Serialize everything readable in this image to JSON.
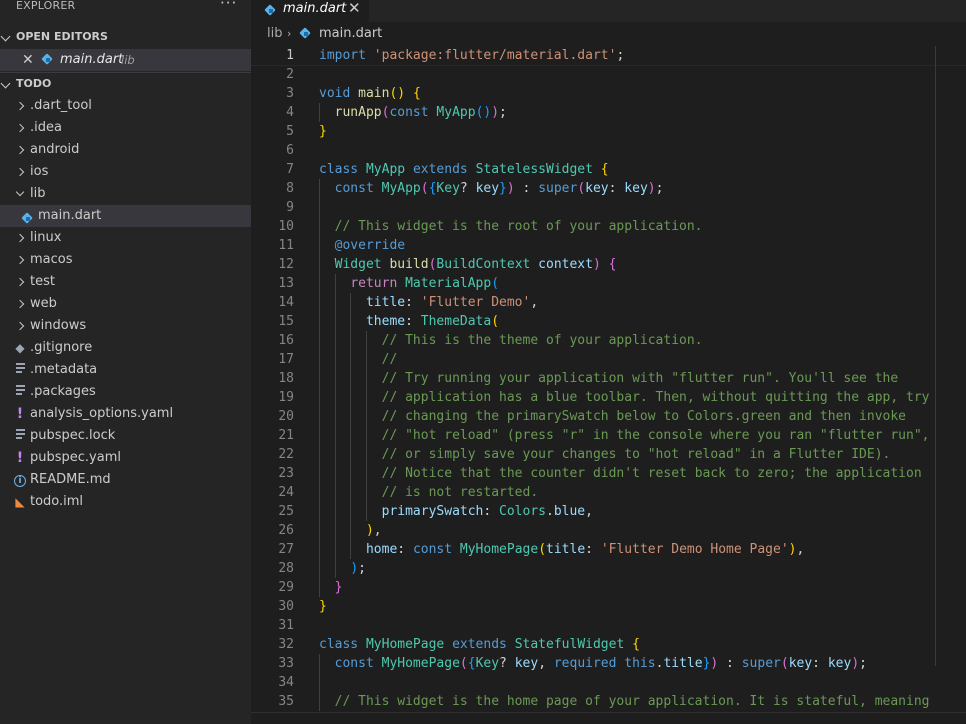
{
  "sidebar": {
    "title": "EXPLORER",
    "more": "···",
    "open_editors": {
      "label": "OPEN EDITORS",
      "items": [
        {
          "name": "main.dart",
          "dir": "lib",
          "close": "✕"
        }
      ]
    },
    "workspace": {
      "label": "TODO",
      "items": [
        {
          "name": ".dart_tool",
          "kind": "folder"
        },
        {
          "name": ".idea",
          "kind": "folder"
        },
        {
          "name": "android",
          "kind": "folder"
        },
        {
          "name": "ios",
          "kind": "folder"
        },
        {
          "name": "lib",
          "kind": "folder-open"
        },
        {
          "name": "main.dart",
          "kind": "dart"
        },
        {
          "name": "linux",
          "kind": "folder"
        },
        {
          "name": "macos",
          "kind": "folder"
        },
        {
          "name": "test",
          "kind": "folder"
        },
        {
          "name": "web",
          "kind": "folder"
        },
        {
          "name": "windows",
          "kind": "folder"
        },
        {
          "name": ".gitignore",
          "kind": "git"
        },
        {
          "name": ".metadata",
          "kind": "lines"
        },
        {
          "name": ".packages",
          "kind": "lines"
        },
        {
          "name": "analysis_options.yaml",
          "kind": "yaml"
        },
        {
          "name": "pubspec.lock",
          "kind": "lines"
        },
        {
          "name": "pubspec.yaml",
          "kind": "yaml"
        },
        {
          "name": "README.md",
          "kind": "info"
        },
        {
          "name": "todo.iml",
          "kind": "rss"
        }
      ]
    }
  },
  "tab": {
    "label": "main.dart",
    "close": "✕"
  },
  "breadcrumb": {
    "folder": "lib",
    "separator": "›",
    "file": "main.dart"
  },
  "colors": {
    "keyword": "#569cd6",
    "control": "#c586c0",
    "string": "#ce9178",
    "type": "#4ec9b0",
    "function": "#dcdcaa",
    "variable": "#9cdcfe",
    "comment": "#6a9955",
    "plain": "#d4d4d4",
    "bracket1": "#ffd700",
    "bracket2": "#da70d6",
    "bracket3": "#179fff"
  },
  "editor": {
    "current_line": 1,
    "lines": [
      {
        "n": 1,
        "indent": 0,
        "tokens": [
          [
            "kw",
            "import"
          ],
          [
            "pl",
            " "
          ],
          [
            "str",
            "'package:flutter/material.dart'"
          ],
          [
            "pl",
            ";"
          ]
        ]
      },
      {
        "n": 2,
        "indent": 0,
        "tokens": []
      },
      {
        "n": 3,
        "indent": 0,
        "tokens": [
          [
            "kw",
            "void"
          ],
          [
            "pl",
            " "
          ],
          [
            "fn",
            "main"
          ],
          [
            "b1",
            "()"
          ],
          [
            "pl",
            " "
          ],
          [
            "b1",
            "{"
          ]
        ]
      },
      {
        "n": 4,
        "indent": 1,
        "tokens": [
          [
            "pl",
            "  "
          ],
          [
            "fn",
            "runApp"
          ],
          [
            "b2",
            "("
          ],
          [
            "kw",
            "const"
          ],
          [
            "pl",
            " "
          ],
          [
            "ty",
            "MyApp"
          ],
          [
            "b3",
            "()"
          ],
          [
            "b2",
            ")"
          ],
          [
            "pl",
            ";"
          ]
        ]
      },
      {
        "n": 5,
        "indent": 0,
        "tokens": [
          [
            "b1",
            "}"
          ]
        ]
      },
      {
        "n": 6,
        "indent": 0,
        "tokens": []
      },
      {
        "n": 7,
        "indent": 0,
        "tokens": [
          [
            "kw",
            "class"
          ],
          [
            "pl",
            " "
          ],
          [
            "ty",
            "MyApp"
          ],
          [
            "pl",
            " "
          ],
          [
            "kw",
            "extends"
          ],
          [
            "pl",
            " "
          ],
          [
            "ty",
            "StatelessWidget"
          ],
          [
            "pl",
            " "
          ],
          [
            "b1",
            "{"
          ]
        ]
      },
      {
        "n": 8,
        "indent": 1,
        "tokens": [
          [
            "pl",
            "  "
          ],
          [
            "kw",
            "const"
          ],
          [
            "pl",
            " "
          ],
          [
            "ty",
            "MyApp"
          ],
          [
            "b2",
            "("
          ],
          [
            "b3",
            "{"
          ],
          [
            "ty",
            "Key"
          ],
          [
            "pl",
            "? "
          ],
          [
            "var",
            "key"
          ],
          [
            "b3",
            "}"
          ],
          [
            "b2",
            ")"
          ],
          [
            "pl",
            " : "
          ],
          [
            "kw",
            "super"
          ],
          [
            "b2",
            "("
          ],
          [
            "var",
            "key"
          ],
          [
            "pl",
            ": "
          ],
          [
            "var",
            "key"
          ],
          [
            "b2",
            ")"
          ],
          [
            "pl",
            ";"
          ]
        ]
      },
      {
        "n": 9,
        "indent": 1,
        "tokens": []
      },
      {
        "n": 10,
        "indent": 1,
        "tokens": [
          [
            "pl",
            "  "
          ],
          [
            "com",
            "// This widget is the root of your application."
          ]
        ]
      },
      {
        "n": 11,
        "indent": 1,
        "tokens": [
          [
            "pl",
            "  "
          ],
          [
            "kw",
            "@override"
          ]
        ]
      },
      {
        "n": 12,
        "indent": 1,
        "tokens": [
          [
            "pl",
            "  "
          ],
          [
            "ty",
            "Widget"
          ],
          [
            "pl",
            " "
          ],
          [
            "fn",
            "build"
          ],
          [
            "b2",
            "("
          ],
          [
            "ty",
            "BuildContext"
          ],
          [
            "pl",
            " "
          ],
          [
            "var",
            "context"
          ],
          [
            "b2",
            ")"
          ],
          [
            "pl",
            " "
          ],
          [
            "b2",
            "{"
          ]
        ]
      },
      {
        "n": 13,
        "indent": 2,
        "tokens": [
          [
            "pl",
            "    "
          ],
          [
            "ctl",
            "return"
          ],
          [
            "pl",
            " "
          ],
          [
            "ty",
            "MaterialApp"
          ],
          [
            "b3",
            "("
          ]
        ]
      },
      {
        "n": 14,
        "indent": 3,
        "tokens": [
          [
            "pl",
            "      "
          ],
          [
            "var",
            "title"
          ],
          [
            "pl",
            ": "
          ],
          [
            "str",
            "'Flutter Demo'"
          ],
          [
            "pl",
            ","
          ]
        ]
      },
      {
        "n": 15,
        "indent": 3,
        "tokens": [
          [
            "pl",
            "      "
          ],
          [
            "var",
            "theme"
          ],
          [
            "pl",
            ": "
          ],
          [
            "ty",
            "ThemeData"
          ],
          [
            "b1",
            "("
          ]
        ]
      },
      {
        "n": 16,
        "indent": 4,
        "tokens": [
          [
            "pl",
            "        "
          ],
          [
            "com",
            "// This is the theme of your application."
          ]
        ]
      },
      {
        "n": 17,
        "indent": 4,
        "tokens": [
          [
            "pl",
            "        "
          ],
          [
            "com",
            "//"
          ]
        ]
      },
      {
        "n": 18,
        "indent": 4,
        "tokens": [
          [
            "pl",
            "        "
          ],
          [
            "com",
            "// Try running your application with \"flutter run\". You'll see the"
          ]
        ]
      },
      {
        "n": 19,
        "indent": 4,
        "tokens": [
          [
            "pl",
            "        "
          ],
          [
            "com",
            "// application has a blue toolbar. Then, without quitting the app, try"
          ]
        ]
      },
      {
        "n": 20,
        "indent": 4,
        "tokens": [
          [
            "pl",
            "        "
          ],
          [
            "com",
            "// changing the primarySwatch below to Colors.green and then invoke"
          ]
        ]
      },
      {
        "n": 21,
        "indent": 4,
        "tokens": [
          [
            "pl",
            "        "
          ],
          [
            "com",
            "// \"hot reload\" (press \"r\" in the console where you ran \"flutter run\","
          ]
        ]
      },
      {
        "n": 22,
        "indent": 4,
        "tokens": [
          [
            "pl",
            "        "
          ],
          [
            "com",
            "// or simply save your changes to \"hot reload\" in a Flutter IDE)."
          ]
        ]
      },
      {
        "n": 23,
        "indent": 4,
        "tokens": [
          [
            "pl",
            "        "
          ],
          [
            "com",
            "// Notice that the counter didn't reset back to zero; the application"
          ]
        ]
      },
      {
        "n": 24,
        "indent": 4,
        "tokens": [
          [
            "pl",
            "        "
          ],
          [
            "com",
            "// is not restarted."
          ]
        ]
      },
      {
        "n": 25,
        "indent": 4,
        "tokens": [
          [
            "pl",
            "        "
          ],
          [
            "var",
            "primarySwatch"
          ],
          [
            "pl",
            ": "
          ],
          [
            "ty",
            "Colors"
          ],
          [
            "pl",
            "."
          ],
          [
            "var",
            "blue"
          ],
          [
            "pl",
            ","
          ]
        ]
      },
      {
        "n": 26,
        "indent": 3,
        "tokens": [
          [
            "pl",
            "      "
          ],
          [
            "b1",
            ")"
          ],
          [
            "pl",
            ","
          ]
        ]
      },
      {
        "n": 27,
        "indent": 3,
        "tokens": [
          [
            "pl",
            "      "
          ],
          [
            "var",
            "home"
          ],
          [
            "pl",
            ": "
          ],
          [
            "kw",
            "const"
          ],
          [
            "pl",
            " "
          ],
          [
            "ty",
            "MyHomePage"
          ],
          [
            "b1",
            "("
          ],
          [
            "var",
            "title"
          ],
          [
            "pl",
            ": "
          ],
          [
            "str",
            "'Flutter Demo Home Page'"
          ],
          [
            "b1",
            ")"
          ],
          [
            "pl",
            ","
          ]
        ]
      },
      {
        "n": 28,
        "indent": 2,
        "tokens": [
          [
            "pl",
            "    "
          ],
          [
            "b3",
            ")"
          ],
          [
            "pl",
            ";"
          ]
        ]
      },
      {
        "n": 29,
        "indent": 1,
        "tokens": [
          [
            "pl",
            "  "
          ],
          [
            "b2",
            "}"
          ]
        ]
      },
      {
        "n": 30,
        "indent": 0,
        "tokens": [
          [
            "b1",
            "}"
          ]
        ]
      },
      {
        "n": 31,
        "indent": 0,
        "tokens": []
      },
      {
        "n": 32,
        "indent": 0,
        "tokens": [
          [
            "kw",
            "class"
          ],
          [
            "pl",
            " "
          ],
          [
            "ty",
            "MyHomePage"
          ],
          [
            "pl",
            " "
          ],
          [
            "kw",
            "extends"
          ],
          [
            "pl",
            " "
          ],
          [
            "ty",
            "StatefulWidget"
          ],
          [
            "pl",
            " "
          ],
          [
            "b1",
            "{"
          ]
        ]
      },
      {
        "n": 33,
        "indent": 1,
        "tokens": [
          [
            "pl",
            "  "
          ],
          [
            "kw",
            "const"
          ],
          [
            "pl",
            " "
          ],
          [
            "ty",
            "MyHomePage"
          ],
          [
            "b2",
            "("
          ],
          [
            "b3",
            "{"
          ],
          [
            "ty",
            "Key"
          ],
          [
            "pl",
            "? "
          ],
          [
            "var",
            "key"
          ],
          [
            "pl",
            ", "
          ],
          [
            "kw",
            "required"
          ],
          [
            "pl",
            " "
          ],
          [
            "kw",
            "this"
          ],
          [
            "pl",
            "."
          ],
          [
            "var",
            "title"
          ],
          [
            "b3",
            "}"
          ],
          [
            "b2",
            ")"
          ],
          [
            "pl",
            " : "
          ],
          [
            "kw",
            "super"
          ],
          [
            "b2",
            "("
          ],
          [
            "var",
            "key"
          ],
          [
            "pl",
            ": "
          ],
          [
            "var",
            "key"
          ],
          [
            "b2",
            ")"
          ],
          [
            "pl",
            ";"
          ]
        ]
      },
      {
        "n": 34,
        "indent": 1,
        "tokens": []
      },
      {
        "n": 35,
        "indent": 1,
        "tokens": [
          [
            "pl",
            "  "
          ],
          [
            "com",
            "// This widget is the home page of your application. It is stateful, meaning"
          ]
        ]
      }
    ]
  }
}
